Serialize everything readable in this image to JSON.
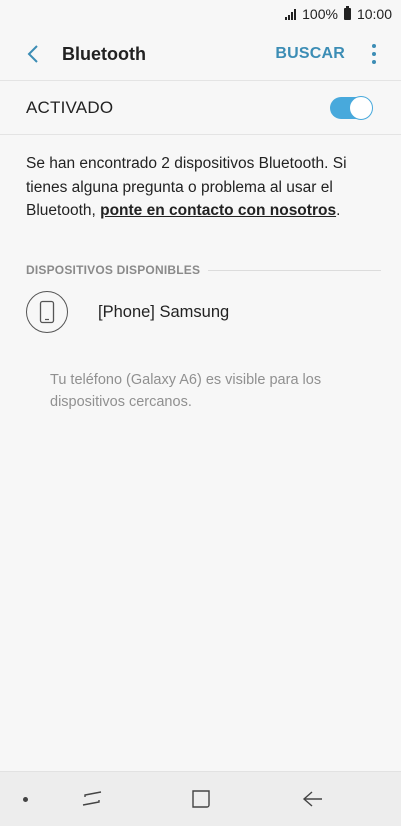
{
  "status_bar": {
    "battery_percent": "100%",
    "time": "10:00",
    "icons": [
      "signal-icon",
      "battery-icon"
    ]
  },
  "app_bar": {
    "back_icon": "chevron-left-icon",
    "title": "Bluetooth",
    "search_label": "BUSCAR",
    "more_icon": "more-vertical-icon"
  },
  "bluetooth_toggle": {
    "label": "ACTIVADO",
    "state": "on",
    "accent_color": "#48a9dc"
  },
  "description": {
    "text": "Se han encontrado 2 dispositivos Bluetooth. Si tienes alguna pregunta o problema al usar el Bluetooth, ",
    "link": "ponte en contacto con nosotros",
    "end": "."
  },
  "available_devices": {
    "header": "DISPOSITIVOS DISPONIBLES",
    "items": [
      {
        "name": "[Phone] Samsung",
        "icon": "phone-icon"
      }
    ]
  },
  "visibility_note": "Tu teléfono (Galaxy A6) es visible para los dispositivos cercanos.",
  "nav_bar": {
    "items": [
      "dot-icon",
      "recents-icon",
      "home-icon",
      "back-arrow-icon"
    ]
  },
  "colors": {
    "accent": "#3c8db5",
    "background": "#f7f7f7",
    "muted_text": "#909090"
  }
}
